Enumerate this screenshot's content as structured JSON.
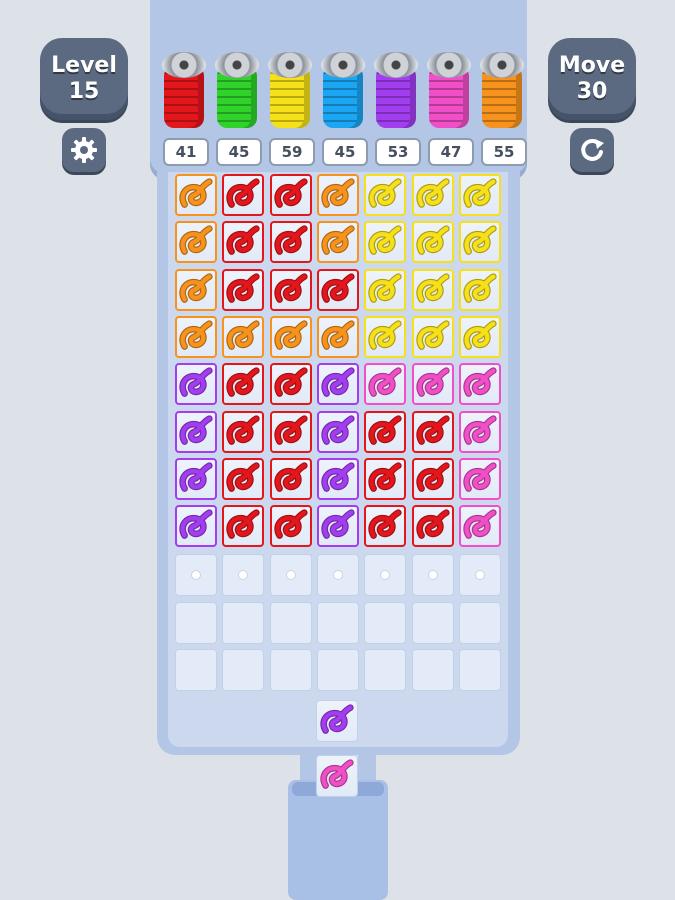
{
  "hud": {
    "level_label": "Level",
    "level_value": "15",
    "move_label": "Move",
    "move_value": "30"
  },
  "icons": {
    "settings": "gear-icon",
    "restart": "restart-icon"
  },
  "colors": {
    "orange": "#f7931d",
    "red": "#e3161c",
    "green": "#2fd32a",
    "yellow": "#f5e01a",
    "blue": "#1aa6f2",
    "purple": "#a33df0",
    "pink": "#f04fc7"
  },
  "spools": [
    {
      "color": "red",
      "count": "41"
    },
    {
      "color": "green",
      "count": "45"
    },
    {
      "color": "yellow",
      "count": "59"
    },
    {
      "color": "blue",
      "count": "45"
    },
    {
      "color": "purple",
      "count": "53"
    },
    {
      "color": "pink",
      "count": "47"
    },
    {
      "color": "orange",
      "count": "55"
    }
  ],
  "grid": [
    [
      "orange",
      "red",
      "red",
      "orange",
      "yellow",
      "yellow",
      "yellow"
    ],
    [
      "orange",
      "red",
      "red",
      "orange",
      "yellow",
      "yellow",
      "yellow"
    ],
    [
      "orange",
      "red",
      "red",
      "red",
      "yellow",
      "yellow",
      "yellow"
    ],
    [
      "orange",
      "orange",
      "orange",
      "orange",
      "yellow",
      "yellow",
      "yellow"
    ],
    [
      "purple",
      "red",
      "red",
      "purple",
      "pink",
      "pink",
      "pink"
    ],
    [
      "purple",
      "red",
      "red",
      "purple",
      "red",
      "red",
      "pink"
    ],
    [
      "purple",
      "red",
      "red",
      "purple",
      "red",
      "red",
      "pink"
    ],
    [
      "purple",
      "red",
      "red",
      "purple",
      "red",
      "red",
      "pink"
    ]
  ],
  "empty_rows": 3,
  "queue": [
    "purple",
    "pink"
  ]
}
